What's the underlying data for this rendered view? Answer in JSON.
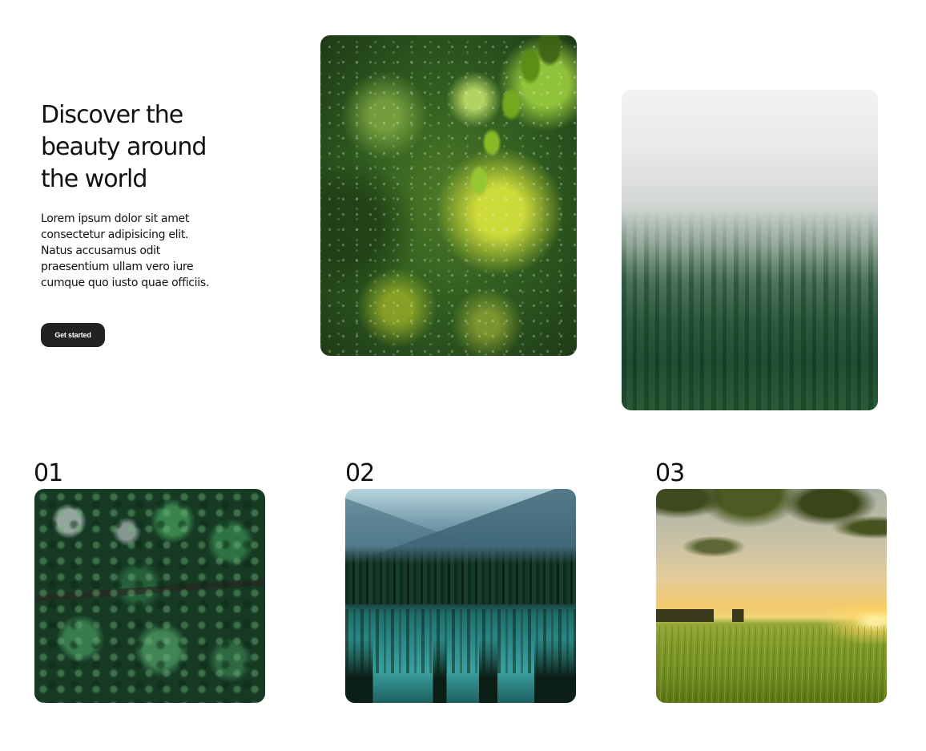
{
  "hero": {
    "title": "Discover the beauty around the world",
    "description": "Lorem ipsum dolor sit amet consectetur adipisicing elit. Natus accusamus odit praesentium ullam vero iure cumque quo iusto quae officiis.",
    "cta_label": "Get started"
  },
  "gallery": [
    {
      "number": "01"
    },
    {
      "number": "02"
    },
    {
      "number": "03"
    }
  ]
}
